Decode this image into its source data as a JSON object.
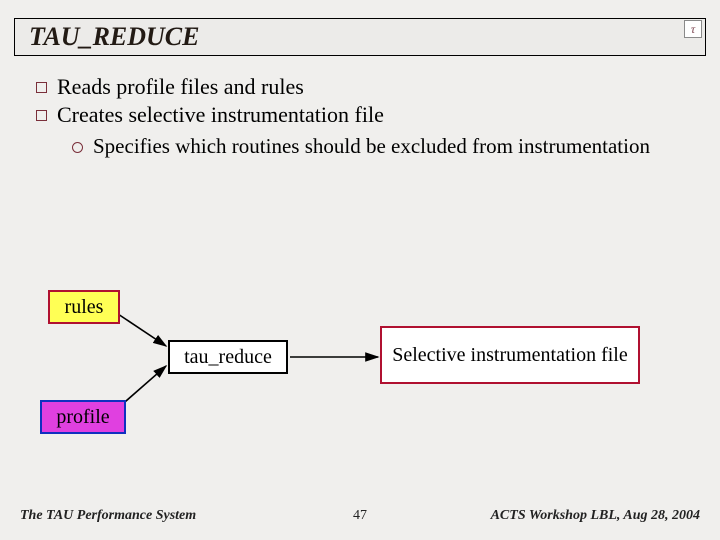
{
  "title": "TAU_REDUCE",
  "logo_glyph": "τ",
  "bullets": [
    "Reads profile files and rules",
    "Creates selective instrumentation file"
  ],
  "subbullets": [
    "Specifies which routines should be excluded from instrumentation"
  ],
  "diagram": {
    "rules": "rules",
    "profile": "profile",
    "tool": "tau_reduce",
    "output": "Selective instrumentation file"
  },
  "footer": {
    "left": "The TAU Performance System",
    "page": "47",
    "right": "ACTS Workshop LBL, Aug 28, 2004"
  }
}
